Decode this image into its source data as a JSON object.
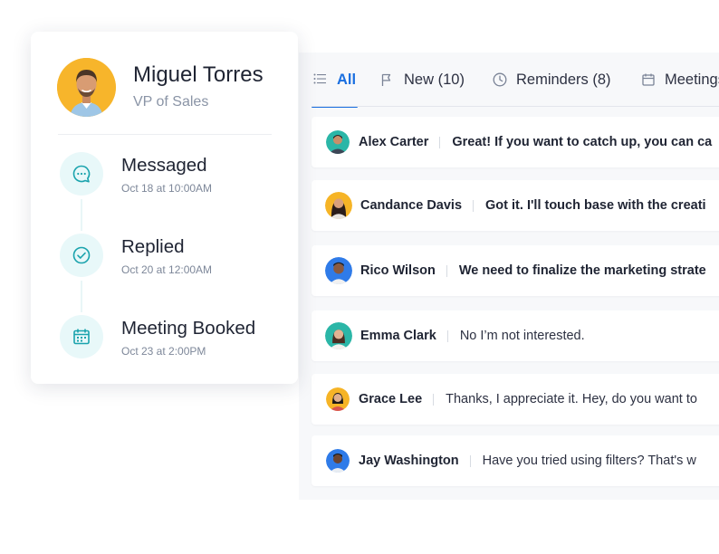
{
  "profile": {
    "name": "Miguel Torres",
    "title": "VP of Sales",
    "avatar_icon": "person-avatar",
    "timeline": [
      {
        "icon": "chat-bubble-icon",
        "label": "Messaged",
        "date": "Oct 18 at 10:00AM"
      },
      {
        "icon": "check-circle-icon",
        "label": "Replied",
        "date": "Oct 20 at 12:00AM"
      },
      {
        "icon": "calendar-icon",
        "label": "Meeting Booked",
        "date": "Oct 23 at 2:00PM"
      }
    ]
  },
  "tabs": [
    {
      "icon": "list-icon",
      "label": "All",
      "active": true
    },
    {
      "icon": "flag-icon",
      "label": "New (10)"
    },
    {
      "icon": "clock-icon",
      "label": "Reminders (8)"
    },
    {
      "icon": "calendar-icon",
      "label": "Meetings"
    }
  ],
  "conversations": [
    {
      "name": "Alex Carter",
      "message": "Great! If you want to catch up, you can ca",
      "unread": true
    },
    {
      "name": "Candance Davis",
      "message": "Got it. I'll touch base with the creati",
      "unread": true
    },
    {
      "name": "Rico Wilson",
      "message": "We need to finalize the marketing strate",
      "unread": true
    },
    {
      "name": "Emma Clark",
      "message": "No I’m not interested.",
      "unread": false
    },
    {
      "name": "Grace Lee",
      "message": "Thanks, I appreciate it. Hey, do you want to",
      "unread": false
    },
    {
      "name": "Jay Washington",
      "message": "Have you tried using filters? That's w",
      "unread": false
    }
  ],
  "colors": {
    "accent": "#1a6fe0",
    "timeline_icon": "#1aa3ad",
    "timeline_icon_bg": "#e8f8f9",
    "avatar_bg": "#f7b52b"
  }
}
